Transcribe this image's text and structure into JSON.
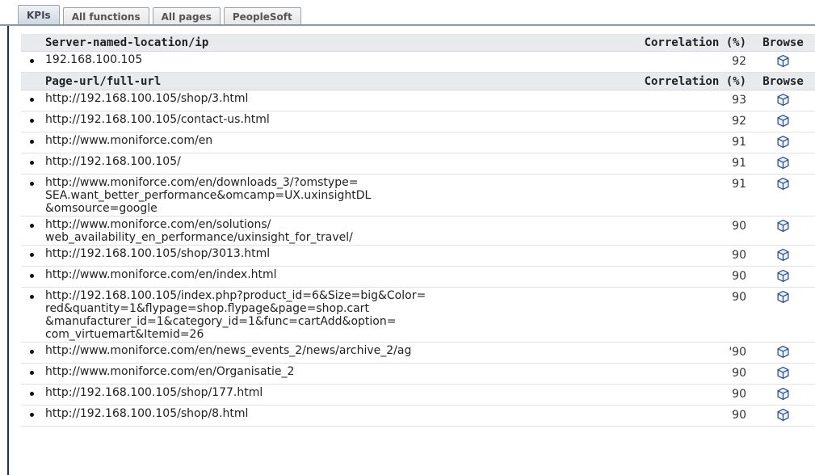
{
  "tabs": [
    "KPIs",
    "All functions",
    "All pages",
    "PeopleSoft"
  ],
  "active_tab": "KPIs",
  "server_section": {
    "header": {
      "url": "Server-named-location/ip",
      "correlation": "Correlation (%)",
      "browse": "Browse"
    },
    "rows": [
      {
        "url": "192.168.100.105",
        "correlation": "92"
      }
    ]
  },
  "page_section": {
    "header": {
      "url": "Page-url/full-url",
      "correlation": "Correlation (%)",
      "browse": "Browse"
    },
    "rows": [
      {
        "url": "http://192.168.100.105/shop/3.html",
        "correlation": "93"
      },
      {
        "url": "http://192.168.100.105/contact-us.html",
        "correlation": "92"
      },
      {
        "url": "http://www.moniforce.com/en",
        "correlation": "91"
      },
      {
        "url": "http://192.168.100.105/",
        "correlation": "91"
      },
      {
        "url": "http://www.moniforce.com/en/downloads_3/?omstype=\nSEA.want_better_performance&omcamp=UX.uxinsightDL\n&omsource=google",
        "correlation": "91"
      },
      {
        "url": "http://www.moniforce.com/en/solutions/\nweb_availability_en_performance/uxinsight_for_travel/",
        "correlation": "90"
      },
      {
        "url": "http://192.168.100.105/shop/3013.html",
        "correlation": "90"
      },
      {
        "url": "http://www.moniforce.com/en/index.html",
        "correlation": "90"
      },
      {
        "url": "http://192.168.100.105/index.php?product_id=6&Size=big&Color=\nred&quantity=1&flypage=shop.flypage&page=shop.cart\n&manufacturer_id=1&category_id=1&func=cartAdd&option=\ncom_virtuemart&Itemid=26",
        "correlation": "90"
      },
      {
        "url": "http://www.moniforce.com/en/news_events_2/news/archive_2/ag",
        "correlation": "'90"
      },
      {
        "url": "http://www.moniforce.com/en/Organisatie_2",
        "correlation": "90"
      },
      {
        "url": "http://192.168.100.105/shop/177.html",
        "correlation": "90"
      },
      {
        "url": "http://192.168.100.105/shop/8.html",
        "correlation": "90"
      }
    ]
  },
  "colors": {
    "accent": "#1a2f6b",
    "header_bg": "#e8ebee",
    "cube": "#2a4f8f"
  },
  "browse_icon": "cube-icon"
}
